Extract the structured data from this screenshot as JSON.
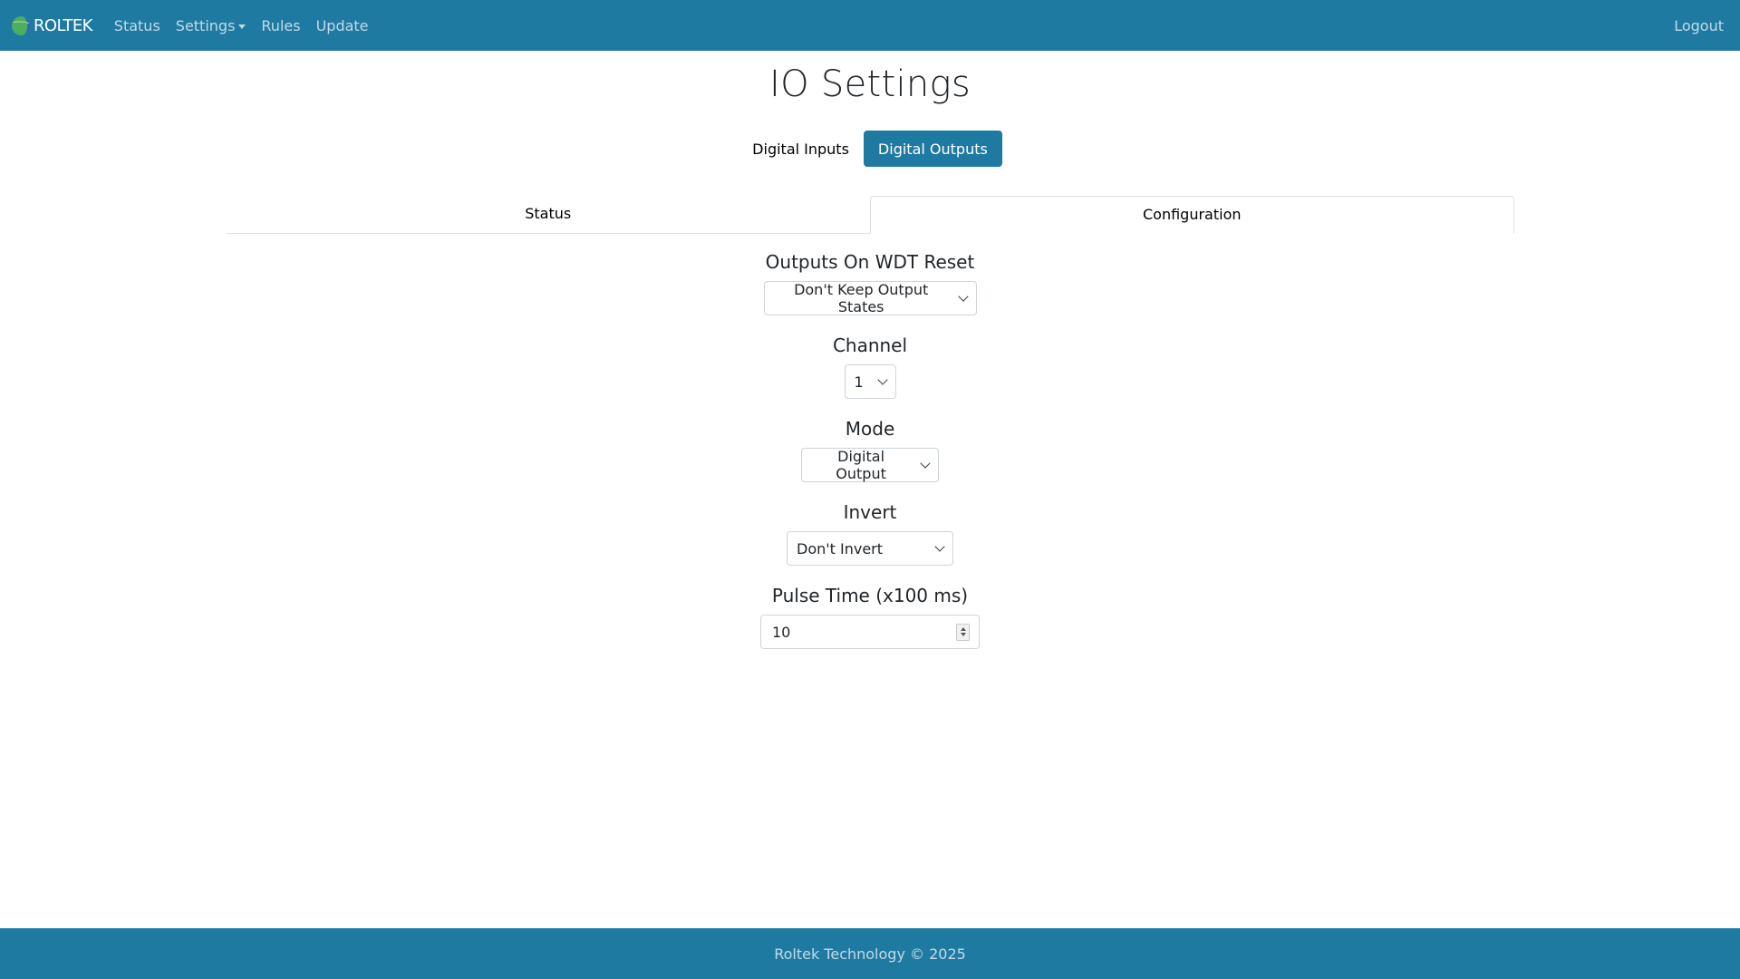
{
  "navbar": {
    "brand": "ROLTEK",
    "items": [
      {
        "label": "Status"
      },
      {
        "label": "Settings"
      },
      {
        "label": "Rules"
      },
      {
        "label": "Update"
      }
    ],
    "logout": "Logout"
  },
  "page": {
    "title": "IO Settings"
  },
  "pills": {
    "inputs": "Digital Inputs",
    "outputs": "Digital Outputs",
    "active": "outputs"
  },
  "tabs": {
    "status": "Status",
    "configuration": "Configuration",
    "active": "configuration"
  },
  "form": {
    "wdt": {
      "label": "Outputs On WDT Reset",
      "value": "Don't Keep Output States"
    },
    "channel": {
      "label": "Channel",
      "value": "1"
    },
    "mode": {
      "label": "Mode",
      "value": "Digital Output"
    },
    "invert": {
      "label": "Invert",
      "value": "Don't Invert"
    },
    "pulse": {
      "label": "Pulse Time (x100 ms)",
      "value": "10"
    }
  },
  "footer": {
    "text": "Roltek Technology © 2025"
  },
  "colors": {
    "primary": "#1f7aa2",
    "nav_text": "rgba(255,255,255,0.72)",
    "border": "#ced4da"
  },
  "icons": {
    "logo": "roltek-globe-logo",
    "dropdown": "chevron-down-icon",
    "spinner": "number-spinner-icon"
  }
}
